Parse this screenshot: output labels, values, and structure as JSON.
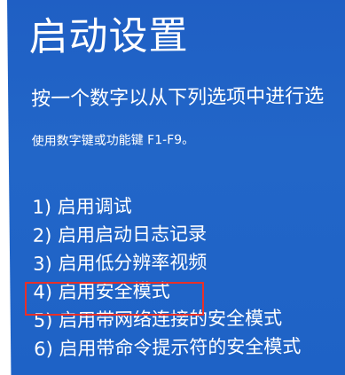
{
  "screen": {
    "title": "启动设置",
    "subtitle": "按一个数字以从下列选项中进行选",
    "hint": "使用数字键或功能键 F1-F9。",
    "options": [
      {
        "label": "1) 启用调试"
      },
      {
        "label": "2) 启用启动日志记录"
      },
      {
        "label": "3) 启用低分辨率视频"
      },
      {
        "label": "4) 启用安全模式"
      },
      {
        "label": "5) 启用带网络连接的安全模式"
      },
      {
        "label": "6) 启用带命令提示符的安全模式"
      }
    ],
    "highlighted_option": "4) 启用安全模式"
  },
  "colors": {
    "background": "#1f5fc4",
    "text": "#ffffff",
    "highlight_border": "#e8302a"
  }
}
